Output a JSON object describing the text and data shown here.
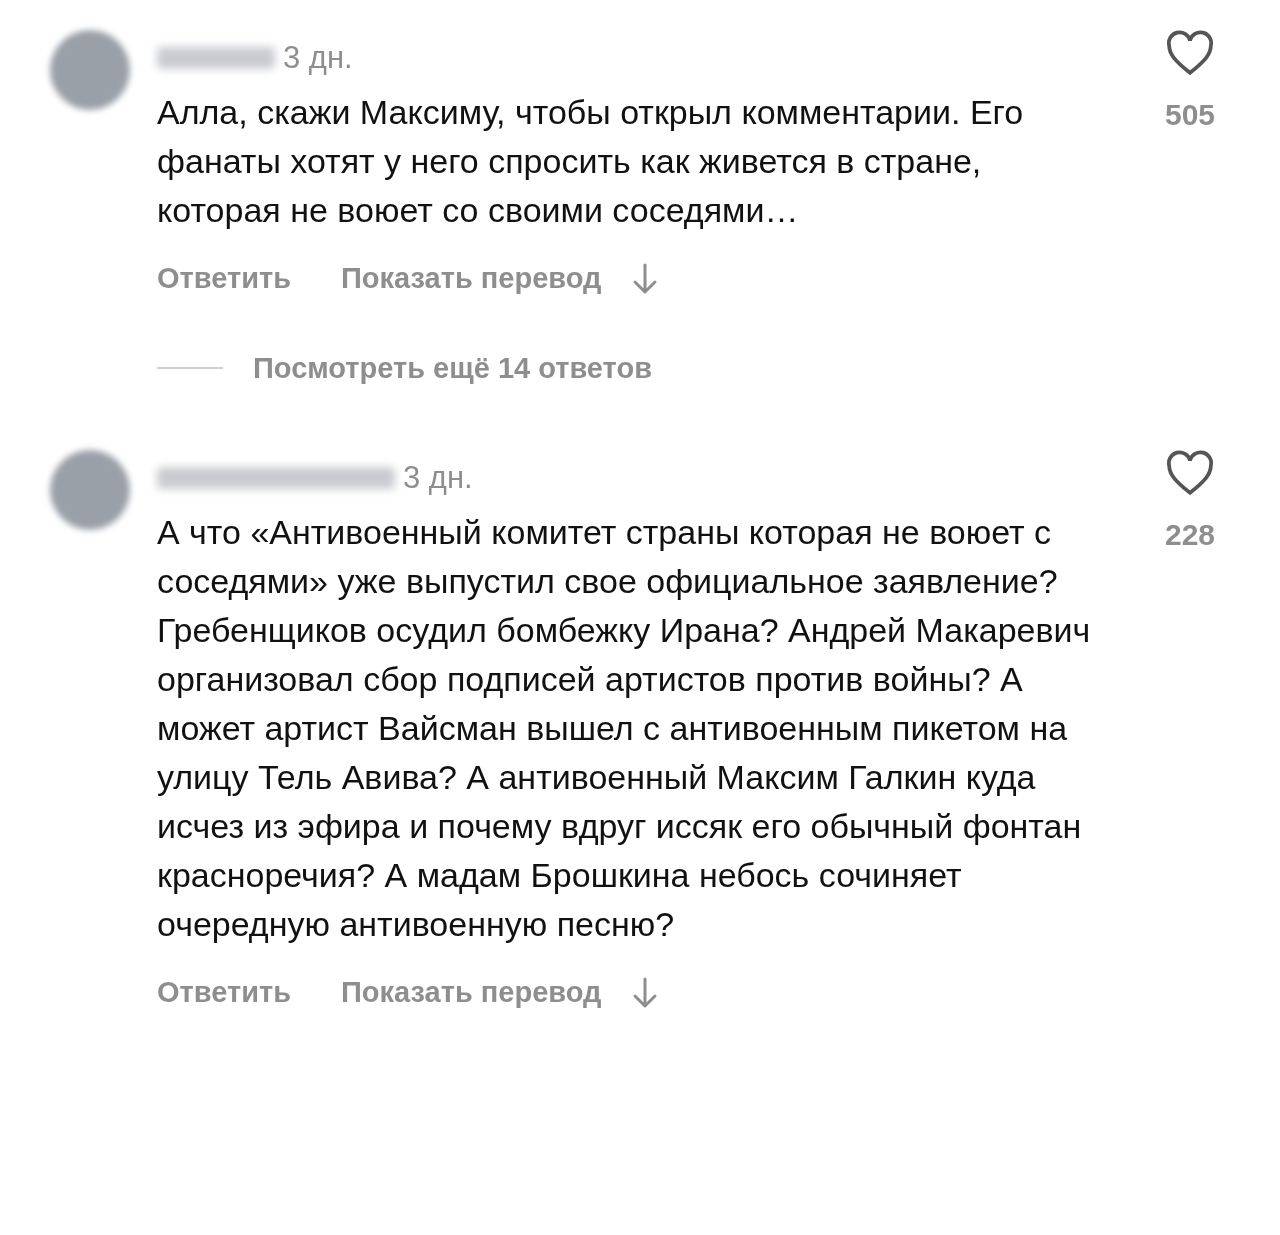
{
  "comments": [
    {
      "time": "3 дн.",
      "text": "Алла, скажи Максиму, чтобы открыл комментарии. Его фанаты хотят у него спросить как живется в стране, которая не воюет со своими соседями…",
      "likes": "505",
      "liked": false,
      "actions": [
        "Ответить",
        "Показать перевод"
      ],
      "replies_link": "Посмотреть ещё 14 ответов"
    },
    {
      "time": "3 дн.",
      "text": "А что «Антивоенный комитет страны которая не воюет с соседями» уже выпустил свое официальное заявление? Гребенщиков осудил бомбежку Ирана? Андрей Макаревич организовал сбор подписей артистов против войны? А может артист Вайсман вышел с антивоенным пикетом на улицу Тель Авива? А антивоенный Максим Галкин куда исчез из эфира и почему вдруг иссяк его обычный фонтан красноречия? А мадам Брошкина небось сочиняет очередную антивоенную песню?",
      "likes": "228",
      "liked": false,
      "actions": [
        "Ответить",
        "Показать перевод"
      ]
    }
  ]
}
